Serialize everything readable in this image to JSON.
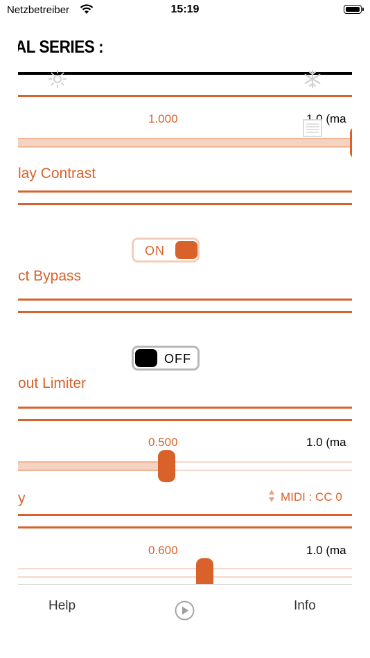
{
  "status_bar": {
    "carrier": "Netzbetreiber",
    "time": "15:19"
  },
  "page": {
    "title": "AL SERIES :"
  },
  "icons": {
    "left": "sun-icon",
    "right": "snowflake-icon",
    "doc": "document-icon"
  },
  "slider_1": {
    "value": "1.000",
    "max": "1.0  (ma",
    "level": 1.0
  },
  "setting_1": {
    "label": "lay Contrast"
  },
  "toggle_1": {
    "label": "ON",
    "state": true
  },
  "setting_2": {
    "label": "ct Bypass"
  },
  "toggle_2": {
    "label": "OFF",
    "state": false
  },
  "setting_3": {
    "label": "out Limiter"
  },
  "slider_2": {
    "value": "0.500",
    "max": "1.0  (ma",
    "level": 0.5
  },
  "setting_4": {
    "label": "y",
    "midi": "MIDI : CC 0"
  },
  "slider_3": {
    "value": "0.600",
    "max": "1.0  (ma",
    "level": 0.6
  },
  "tabbar": {
    "help": "Help",
    "info": "Info"
  },
  "colors": {
    "accent": "#d9622b",
    "track": "#f4d3c3"
  }
}
